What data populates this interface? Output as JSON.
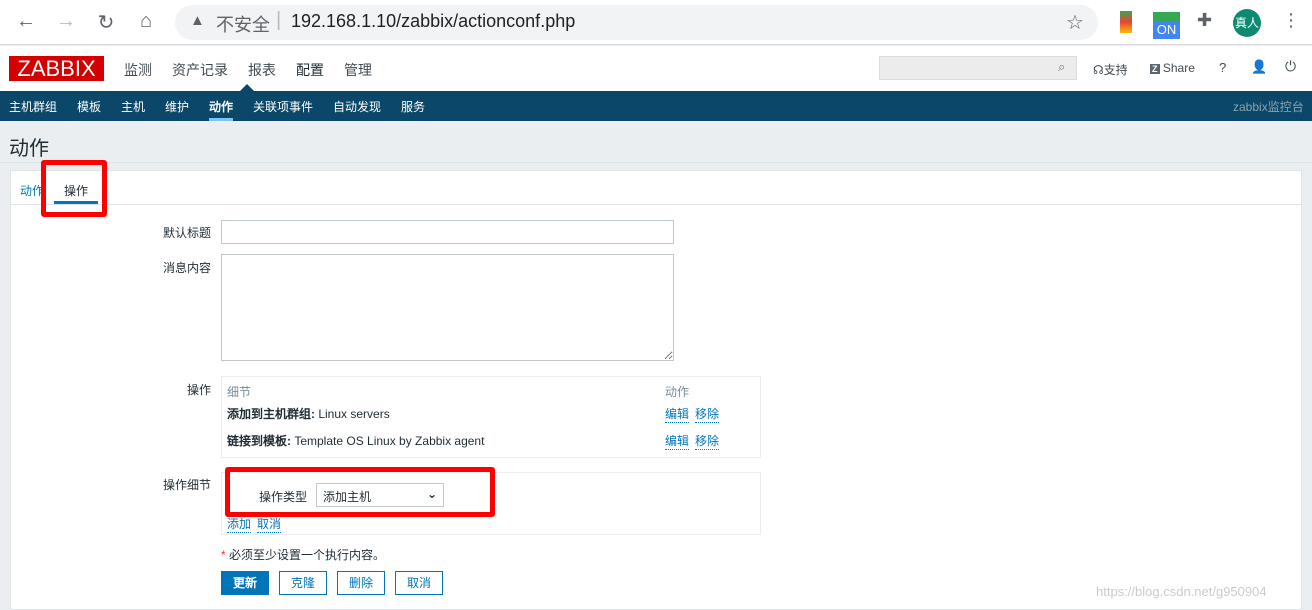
{
  "browser": {
    "security": "不安全",
    "url": "192.168.1.10/zabbix/actionconf.php",
    "ext_on": "ON",
    "avatar": "真人"
  },
  "header": {
    "logo": "ZABBIX",
    "menu": [
      "监测",
      "资产记录",
      "报表",
      "配置",
      "管理"
    ],
    "support": "支持",
    "share": "Share",
    "help": "?"
  },
  "subnav": {
    "items": [
      "主机群组",
      "模板",
      "主机",
      "维护",
      "动作",
      "关联项事件",
      "自动发现",
      "服务"
    ],
    "active": "动作",
    "right": "zabbix监控台"
  },
  "page": {
    "title": "动作"
  },
  "tabs": [
    "动作",
    "操作"
  ],
  "form": {
    "default_subject_label": "默认标题",
    "default_subject_value": "",
    "message_label": "消息内容",
    "message_value": "",
    "operations_label": "操作",
    "ops_header": {
      "details": "细节",
      "action": "动作"
    },
    "operations": [
      {
        "type": "添加到主机群组:",
        "value": " Linux servers",
        "edit": "编辑",
        "remove": "移除"
      },
      {
        "type": "链接到模板:",
        "value": " Template OS Linux by Zabbix agent",
        "edit": "编辑",
        "remove": "移除"
      }
    ],
    "op_details_label": "操作细节",
    "op_type_label": "操作类型",
    "op_type_value": "添加主机",
    "add": "添加",
    "cancel_link": "取消",
    "required_note": "必须至少设置一个执行内容。"
  },
  "buttons": {
    "update": "更新",
    "clone": "克隆",
    "delete": "删除",
    "cancel": "取消"
  },
  "watermark": "https://blog.csdn.net/g950904",
  "colors": {
    "brand": "#d40000",
    "nav": "#0b4768",
    "accent": "#0275b8",
    "highlight": "#ff0000"
  }
}
